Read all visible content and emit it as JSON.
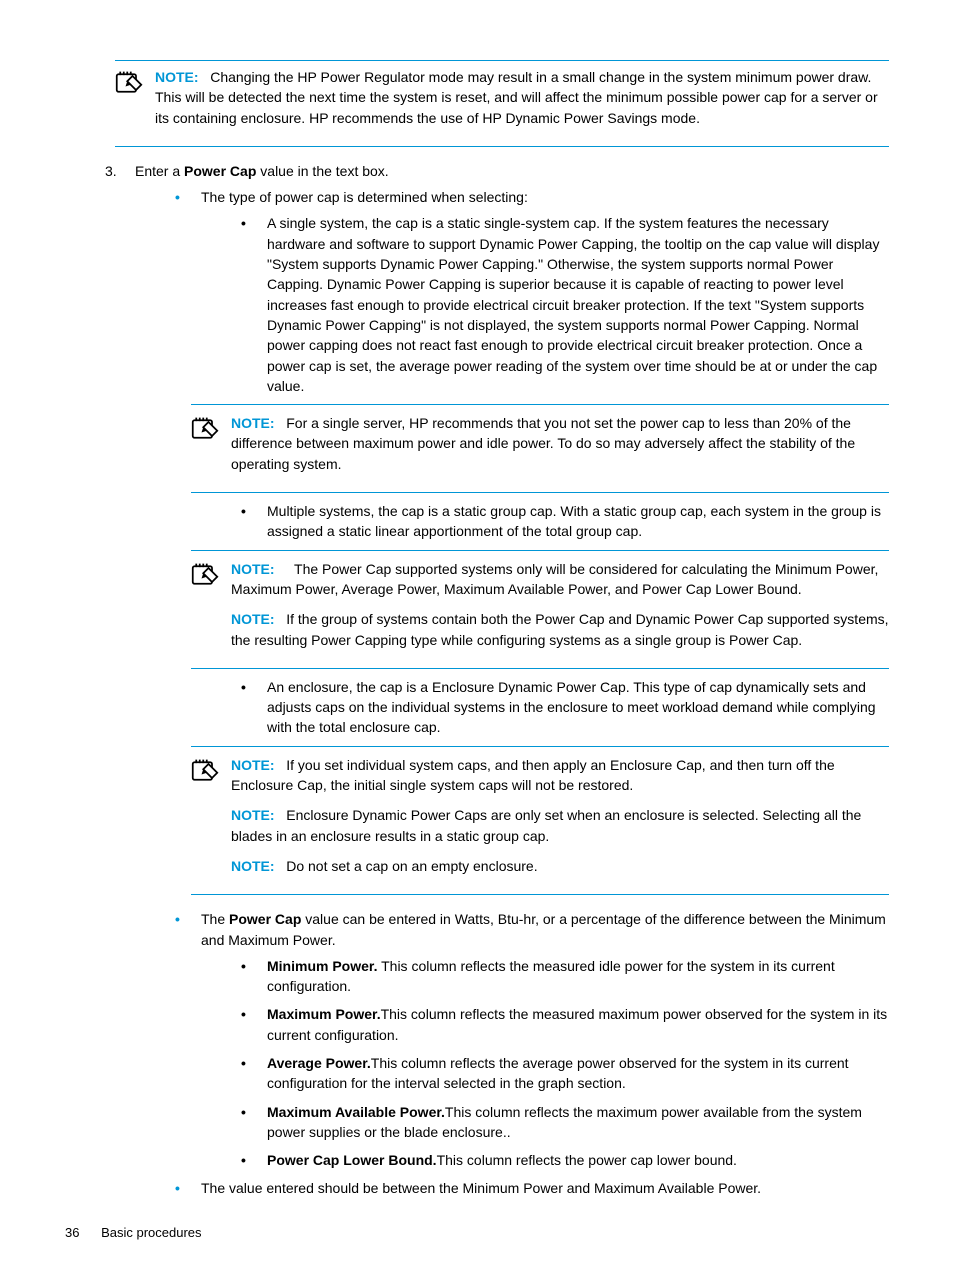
{
  "footer": {
    "page_number": "36",
    "section": "Basic procedures"
  },
  "noteLabel": "NOTE:",
  "note1": {
    "body": "Changing the HP Power Regulator mode may result in a small change in the system minimum power draw. This will be detected the next time the system is reset, and will affect the minimum possible power cap for a server or its containing enclosure. HP recommends the use of HP Dynamic Power Savings mode."
  },
  "step3": {
    "number": "3",
    "pre": "Enter a ",
    "boldA": "Power Cap",
    "post": " value in the text box.",
    "bullet_a": "The type of power cap is determined when selecting:",
    "sub_a1": "A single system, the cap is a static single-system cap. If the system features the necessary hardware and software to support Dynamic Power Capping, the tooltip on the cap value will display \"System supports Dynamic Power Capping.\" Otherwise, the system supports normal Power Capping. Dynamic Power Capping is superior because it is capable of reacting to power level increases fast enough to provide electrical circuit breaker protection. If the text \"System supports Dynamic Power Capping\" is not displayed, the system supports normal Power Capping. Normal power capping does not react fast enough to provide electrical circuit breaker protection. Once a power cap is set, the average power reading of the system over time should be at or under the cap value."
  },
  "note2": {
    "body": "For a single server, HP recommends that you not set the power cap to less than 20% of the difference between maximum power and idle power. To do so may adversely affect the stability of the operating system."
  },
  "step3_sub": {
    "sub_a2": "Multiple systems, the cap is a static group cap. With a static group cap, each system in the group is assigned a static linear apportionment of the total group cap."
  },
  "note3": {
    "p1": "The Power Cap supported systems only will be considered for calculating the Minimum Power, Maximum Power, Average Power, Maximum Available Power, and Power Cap Lower Bound.",
    "p2": "If the group of systems contain both the Power Cap and Dynamic Power Cap supported systems, the resulting Power Capping type while configuring systems as a single group is Power Cap."
  },
  "step3_sub2": {
    "sub_a3": "An enclosure, the cap is a Enclosure Dynamic Power Cap. This type of cap dynamically sets and adjusts caps on the individual systems in the enclosure to meet workload demand while complying with the total enclosure cap."
  },
  "note4": {
    "p1": "If you set individual system caps, and then apply an Enclosure Cap, and then turn off the Enclosure Cap, the initial single system caps will not be restored.",
    "p2": "Enclosure Dynamic Power Caps are only set when an enclosure is selected. Selecting all the blades in an enclosure results in a static group cap.",
    "p3": "Do not set a cap on an empty enclosure."
  },
  "bullet_b": {
    "pre": "The ",
    "boldA": "Power Cap",
    "post": " value can be entered in Watts, Btu-hr, or a percentage of the difference between the Minimum and Maximum Power.",
    "defs": [
      {
        "term": "Minimum Power.",
        "desc": " This column reflects the measured idle power for the system in its current configuration."
      },
      {
        "term": "Maximum Power.",
        "desc": "This column reflects the measured maximum power observed for the system in its current configuration."
      },
      {
        "term": "Average Power.",
        "desc": "This column reflects the average power observed for the system in its current configuration for the interval selected in the graph section."
      },
      {
        "term": "Maximum Available Power.",
        "desc": "This column reflects the maximum power available from the system power supplies or the blade enclosure.."
      },
      {
        "term": "Power Cap Lower Bound.",
        "desc": "This column reflects the power cap lower bound."
      }
    ]
  },
  "bullet_c": "The value entered should be between the Minimum Power and Maximum Available Power."
}
